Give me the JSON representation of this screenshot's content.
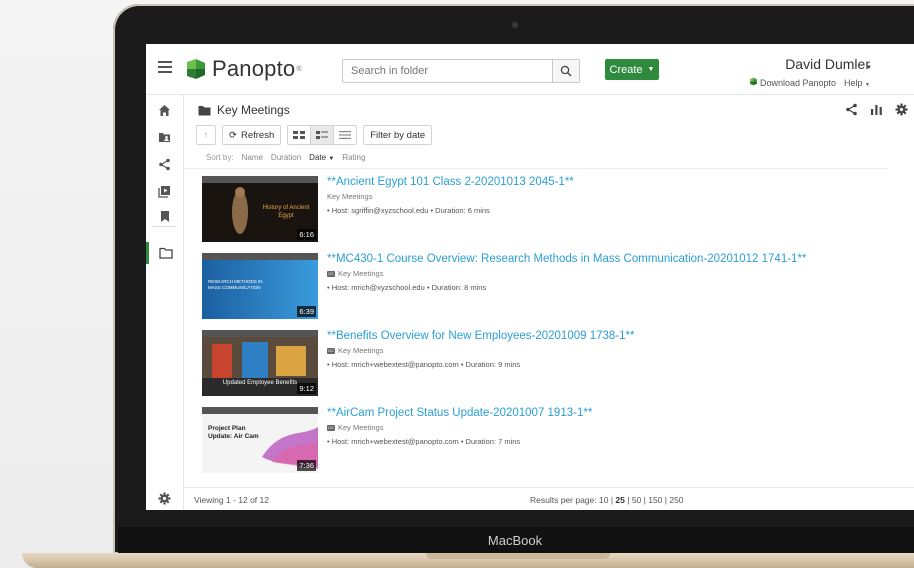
{
  "device": {
    "brand": "MacBook"
  },
  "header": {
    "logo_text": "Panopto",
    "logo_tm": "®",
    "search_placeholder": "Search in folder",
    "create_label": "Create",
    "user_name": "David Dumler",
    "download_label": "Download Panopto",
    "help_label": "Help"
  },
  "folder": {
    "title": "Key Meetings"
  },
  "toolbar": {
    "refresh_label": "Refresh",
    "filter_label": "Filter by date"
  },
  "sort": {
    "label": "Sort by:",
    "options": [
      "Name",
      "Duration",
      "Date",
      "Rating"
    ],
    "active": "Date"
  },
  "items": [
    {
      "title": "**Ancient Egypt 101 Class 2-20201013 2045-1**",
      "folder": "Key Meetings",
      "meta": "• Host: sgriffin@xyzschool.edu   • Duration: 6 mins",
      "duration": "6:16",
      "thumb_text": "History of Ancient Egypt",
      "captions": false
    },
    {
      "title": "**MC430-1 Course Overview: Research Methods in Mass Communication-20201012 1741-1**",
      "folder": "Key Meetings",
      "meta": "• Host: mrich@xyzschool.edu   • Duration: 8 mins",
      "duration": "6:39",
      "thumb_text": "RESEARCH METHODS IN MASS COMMUNICATION",
      "captions": true
    },
    {
      "title": "**Benefits Overview for New Employees-20201009 1738-1**",
      "folder": "Key Meetings",
      "meta": "• Host: mrich+webextest@panopto.com   • Duration: 9 mins",
      "duration": "9:12",
      "thumb_text": "Updated Employee Benefits",
      "captions": true
    },
    {
      "title": "**AirCam Project Status Update-20201007 1913-1**",
      "folder": "Key Meetings",
      "meta": "• Host: mrich+webextest@panopto.com   • Duration: 7 mins",
      "duration": "7:36",
      "thumb_text": "Project Plan Update: Air Cam",
      "captions": true
    }
  ],
  "footer": {
    "viewing": "Viewing 1 - 12 of 12",
    "results_label": "Results per page:",
    "page_sizes": [
      "10",
      "25",
      "50",
      "150",
      "250"
    ],
    "selected_page_size": "25"
  },
  "colors": {
    "brand_green": "#2e8b3d",
    "link_blue": "#2a9fd6"
  }
}
